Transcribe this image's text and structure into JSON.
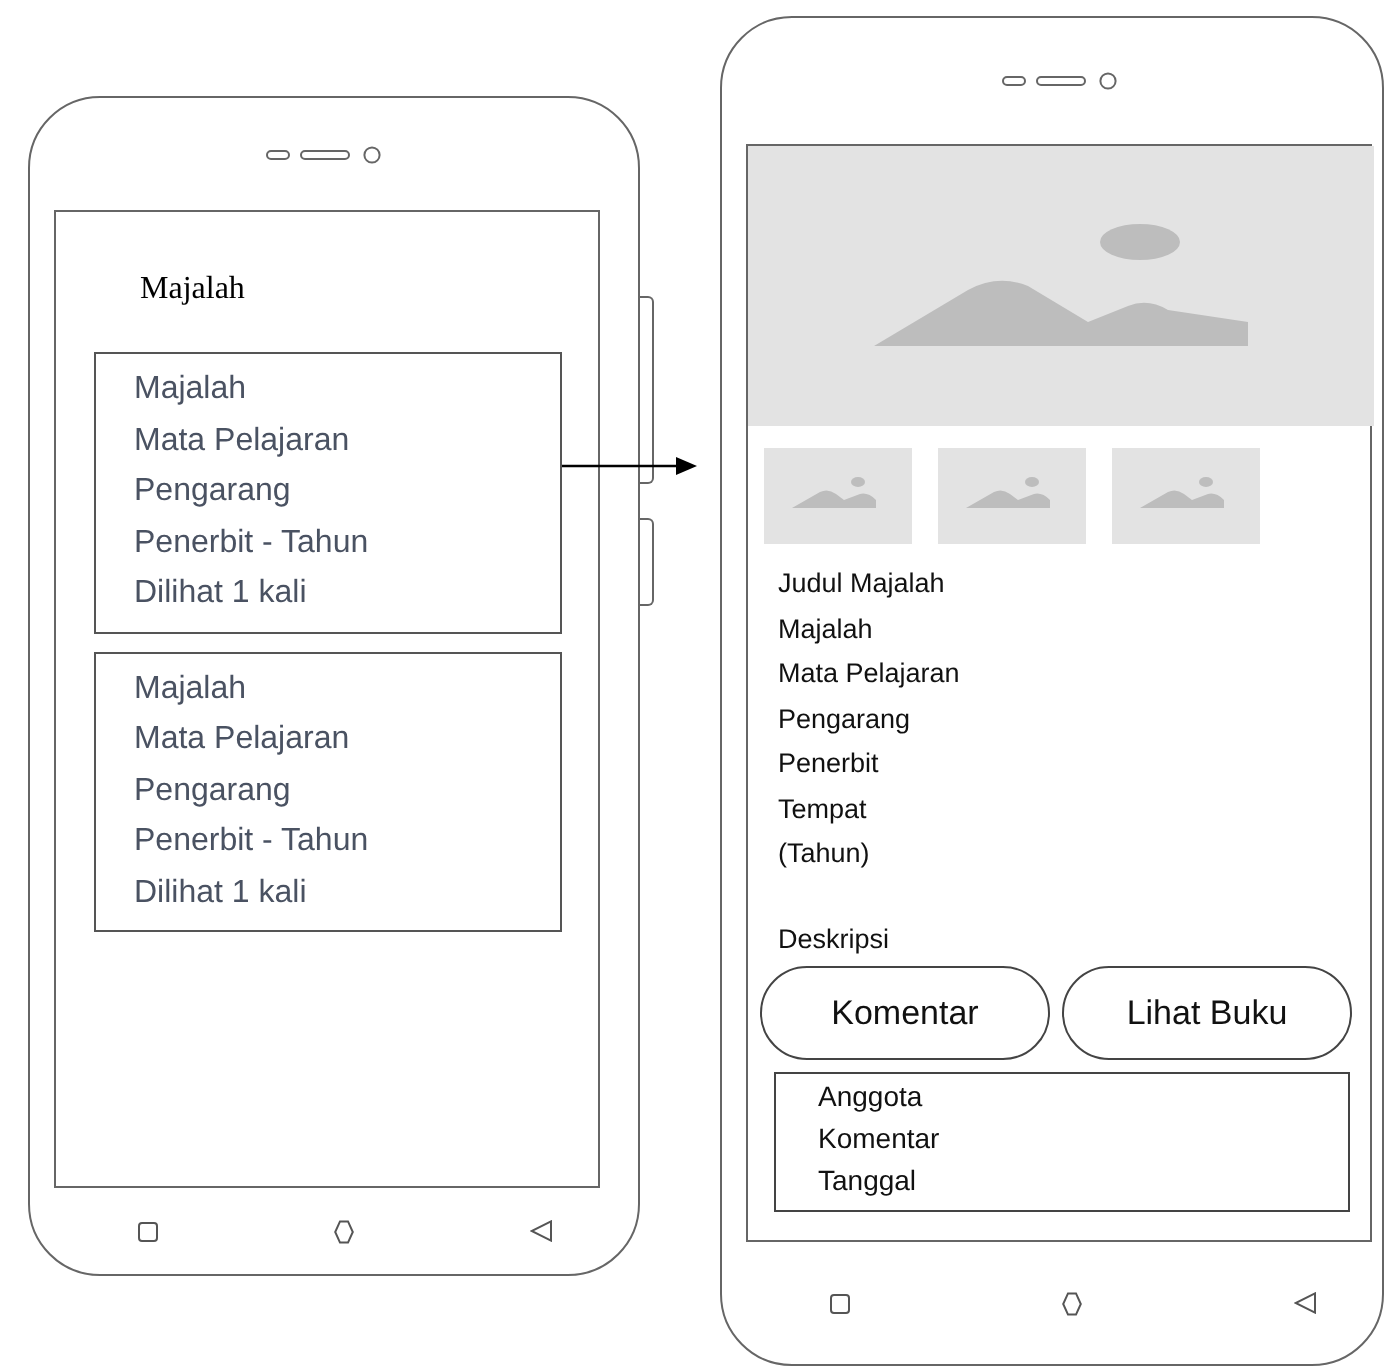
{
  "list_screen": {
    "title": "Majalah",
    "cards": [
      {
        "lines": [
          "Majalah",
          "Mata Pelajaran",
          "Pengarang",
          "Penerbit - Tahun",
          "Dilihat 1 kali"
        ]
      },
      {
        "lines": [
          "Majalah",
          "Mata Pelajaran",
          "Pengarang",
          "Penerbit - Tahun",
          "Dilihat 1 kali"
        ]
      }
    ]
  },
  "detail_screen": {
    "info_lines": [
      "Judul Majalah",
      "Majalah",
      "Mata Pelajaran",
      "Pengarang",
      "Penerbit",
      "Tempat",
      "(Tahun)"
    ],
    "description_label": "Deskripsi",
    "buttons": [
      "Komentar",
      "Lihat Buku"
    ],
    "comment_box": {
      "lines": [
        "Anggota",
        "Komentar",
        "Tanggal"
      ]
    }
  }
}
